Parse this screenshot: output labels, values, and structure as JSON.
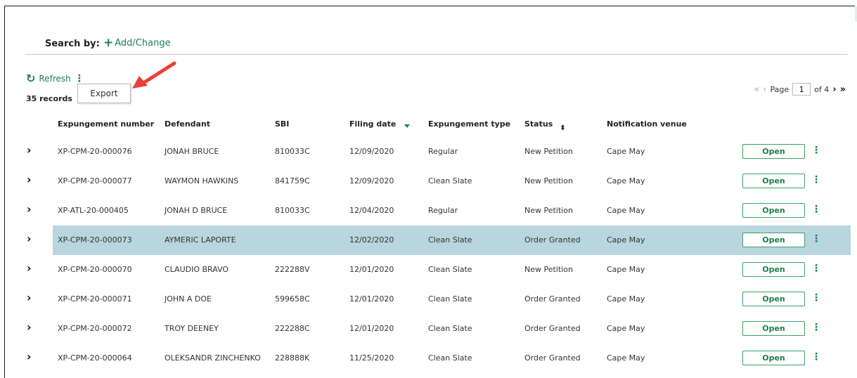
{
  "search": {
    "label": "Search by:",
    "add_change": "Add/Change",
    "plus": "+"
  },
  "toolbar": {
    "refresh": "Refresh",
    "refresh_glyph": "↻",
    "kebab_glyph": "⋮",
    "records": "35 records",
    "export": "Export"
  },
  "pager": {
    "first": "«",
    "prev": "‹",
    "page_label": "Page",
    "page_value": "1",
    "of": "of 4",
    "next": "›",
    "last": "»"
  },
  "columns": {
    "expungement_number": "Expungement number",
    "defendant": "Defendant",
    "sbi": "SBI",
    "filing_date": "Filing date",
    "expungement_type": "Expungement type",
    "status": "Status",
    "notification_venue": "Notification venue"
  },
  "status_sort_glyph": "⬍",
  "rows": [
    {
      "number": "XP-CPM-20-000076",
      "defendant": "JONAH BRUCE",
      "sbi": "810033C",
      "date": "12/09/2020",
      "type": "Regular",
      "status": "New Petition",
      "venue": "Cape May",
      "action": "Open",
      "chevron": "›",
      "kebab": "⋮"
    },
    {
      "number": "XP-CPM-20-000077",
      "defendant": "WAYMON HAWKINS",
      "sbi": "841759C",
      "date": "12/09/2020",
      "type": "Clean Slate",
      "status": "New Petition",
      "venue": "Cape May",
      "action": "Open",
      "chevron": "›",
      "kebab": "⋮"
    },
    {
      "number": "XP-ATL-20-000405",
      "defendant": "JONAH D BRUCE",
      "sbi": "810033C",
      "date": "12/04/2020",
      "type": "Regular",
      "status": "New Petition",
      "venue": "Cape May",
      "action": "Open",
      "chevron": "›",
      "kebab": "⋮"
    },
    {
      "number": "XP-CPM-20-000073",
      "defendant": "AYMERIC LAPORTE",
      "sbi": "",
      "date": "12/02/2020",
      "type": "Clean Slate",
      "status": "Order Granted",
      "venue": "Cape May",
      "action": "Open",
      "chevron": "›",
      "kebab": "⋮"
    },
    {
      "number": "XP-CPM-20-000070",
      "defendant": "CLAUDIO BRAVO",
      "sbi": "222288V",
      "date": "12/01/2020",
      "type": "Clean Slate",
      "status": "New Petition",
      "venue": "Cape May",
      "action": "Open",
      "chevron": "›",
      "kebab": "⋮"
    },
    {
      "number": "XP-CPM-20-000071",
      "defendant": "JOHN A DOE",
      "sbi": "599658C",
      "date": "12/01/2020",
      "type": "Clean Slate",
      "status": "Order Granted",
      "venue": "Cape May",
      "action": "Open",
      "chevron": "›",
      "kebab": "⋮"
    },
    {
      "number": "XP-CPM-20-000072",
      "defendant": "TROY DEENEY",
      "sbi": "222288C",
      "date": "12/01/2020",
      "type": "Clean Slate",
      "status": "Order Granted",
      "venue": "Cape May",
      "action": "Open",
      "chevron": "›",
      "kebab": "⋮"
    },
    {
      "number": "XP-CPM-20-000064",
      "defendant": "OLEKSANDR ZINCHENKO",
      "sbi": "228888K",
      "date": "11/25/2020",
      "type": "Clean Slate",
      "status": "Order Granted",
      "venue": "Cape May",
      "action": "Open",
      "chevron": "›",
      "kebab": "⋮"
    }
  ],
  "selected_row": 3,
  "colors": {
    "accent": "#19814a",
    "selected_row": "#b8d6dd",
    "callout_arrow": "#e8413a"
  }
}
